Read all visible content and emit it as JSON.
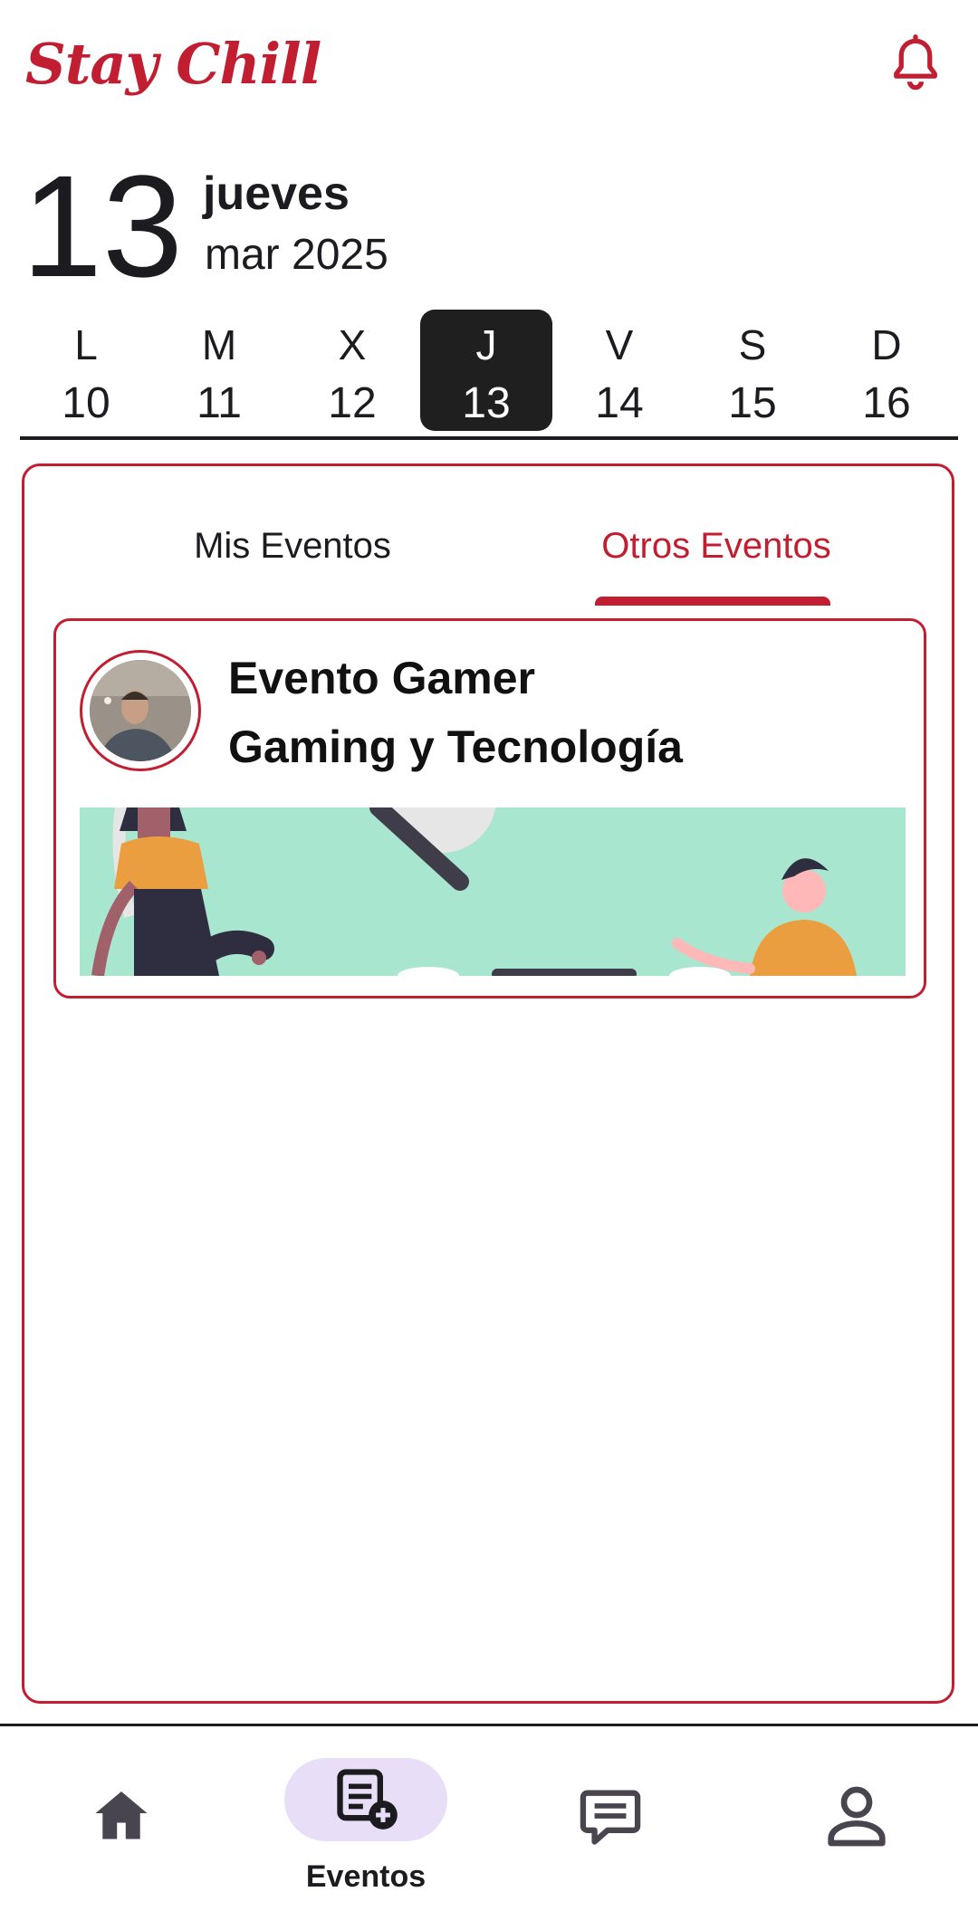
{
  "app": {
    "brand": "Stay Chill"
  },
  "date": {
    "day_number": "13",
    "weekday": "jueves",
    "month_year": "mar 2025"
  },
  "week": [
    {
      "letter": "L",
      "number": "10",
      "selected": false
    },
    {
      "letter": "M",
      "number": "11",
      "selected": false
    },
    {
      "letter": "X",
      "number": "12",
      "selected": false
    },
    {
      "letter": "J",
      "number": "13",
      "selected": true
    },
    {
      "letter": "V",
      "number": "14",
      "selected": false
    },
    {
      "letter": "S",
      "number": "15",
      "selected": false
    },
    {
      "letter": "D",
      "number": "16",
      "selected": false
    }
  ],
  "tabs": {
    "mine": "Mis Eventos",
    "other": "Otros Eventos",
    "active": "other"
  },
  "events": [
    {
      "title": "Evento Gamer",
      "subtitle": "Gaming y Tecnología"
    }
  ],
  "nav": {
    "events_label": "Eventos",
    "active": "events"
  },
  "colors": {
    "accent": "#c21e32",
    "selected_day_bg": "#1f1f1f",
    "banner_bg": "#a8e6d0",
    "nav_pill": "#e8def8"
  },
  "icons": [
    "bell-icon",
    "home-icon",
    "events-add-icon",
    "chat-icon",
    "profile-icon"
  ]
}
